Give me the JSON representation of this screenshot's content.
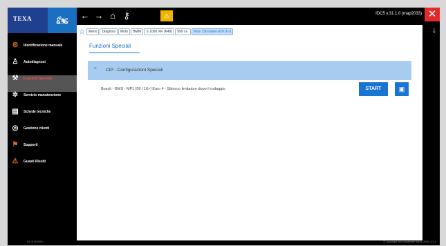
{
  "brand": "TEXA",
  "topbar": {
    "version": "IDC5 v.31.1.0 (map2033)",
    "icons": [
      "back-arrow-icon",
      "forward-arrow-icon",
      "home-icon",
      "key-icon",
      "warning-icon",
      "close-icon",
      "download-arrow-icon"
    ],
    "glyphs": {
      "back": "←",
      "forward": "→",
      "home": "⌂",
      "key": "⚷",
      "warn": "⚠",
      "close": "✕",
      "down": "↓",
      "moto": "🏍"
    }
  },
  "breadcrumb": {
    "items": [
      "Menù",
      "Diagnosi",
      "Moto",
      "BMW",
      "S 1000 XR (K49)",
      "999 i.e.",
      "Moto (Stradale)-[09/16>]"
    ]
  },
  "sidebar": {
    "items": [
      {
        "label": "Identificazione manuale",
        "icon": "gear-icon",
        "glyph": "⚙"
      },
      {
        "label": "Autodiagnosi",
        "icon": "person-icon",
        "glyph": "♙"
      },
      {
        "label": "Funzioni Speciali",
        "icon": "special-functions-icon",
        "glyph": "⚒"
      },
      {
        "label": "Servizio manutenzione",
        "icon": "service-icon",
        "glyph": "✲"
      },
      {
        "label": "Schede tecniche",
        "icon": "tech-sheet-icon",
        "glyph": "▤"
      },
      {
        "label": "Gestione clienti",
        "icon": "customer-icon",
        "glyph": "◎"
      },
      {
        "label": "Supporti",
        "icon": "support-icon",
        "glyph": "⚑"
      },
      {
        "label": "Guasti Risolti",
        "icon": "solved-faults-icon",
        "glyph": "⚠"
      }
    ],
    "selected_index": 2
  },
  "main": {
    "title": "Funzioni Speciali",
    "section_label": "CIP - Configurazioni Speciali",
    "row_text": "Bosch - BMS - MP1 [09 / 16>] Euro 4 - Sblocco limitatore dopo il rodaggio",
    "start_label": "START",
    "info_glyph": "▣"
  },
  "footer": {
    "left": "IDC5 000000",
    "right": "© copyright and database rights 2000-2019"
  },
  "colors": {
    "brand": "#1f3f8f",
    "accent": "#1a74d1",
    "section": "#a7ccef",
    "close": "#e22a2a",
    "warn": "#f0b400"
  }
}
